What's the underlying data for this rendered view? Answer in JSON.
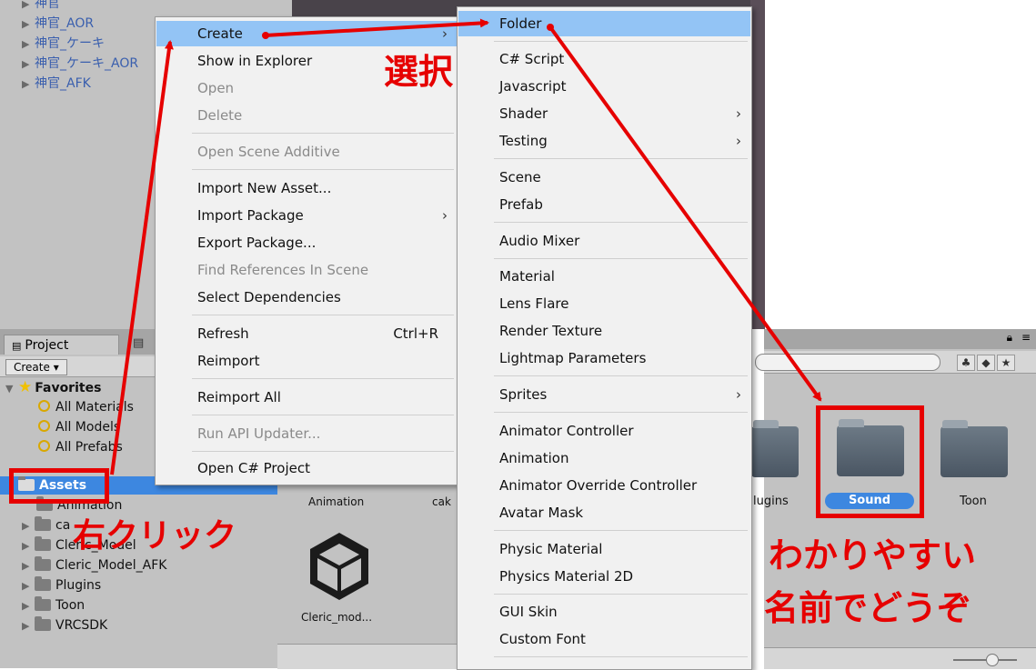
{
  "hierarchy": {
    "items": [
      "神官",
      "神官_AOR",
      "神官_ケーキ",
      "神官_ケーキ_AOR",
      "神官_AFK"
    ]
  },
  "project_panel": {
    "tab_label": "Project",
    "create_label": "Create ▾",
    "favorites": "Favorites",
    "favorite_items": [
      "All Materials",
      "All Models",
      "All Prefabs"
    ],
    "assets_label": "Assets",
    "asset_folders": [
      "Animation",
      "ca",
      "Cleric_Model",
      "Cleric_Model_AFK",
      "Plugins",
      "Toon",
      "VRCSDK"
    ]
  },
  "asset_grid": {
    "labels": [
      "Animation",
      "cak",
      "Cleric_mod..."
    ]
  },
  "right_pane": {
    "folder_labels": [
      "lugins",
      "Sound",
      "Toon"
    ]
  },
  "context_menu": {
    "items": [
      {
        "label": "Create",
        "arrow": "›"
      },
      {
        "label": "Show in Explorer"
      },
      {
        "label": "Open"
      },
      {
        "label": "Delete"
      },
      {
        "label": "Open Scene Additive"
      },
      {
        "label": "Import New Asset..."
      },
      {
        "label": "Import Package",
        "arrow": "›"
      },
      {
        "label": "Export Package..."
      },
      {
        "label": "Find References In Scene"
      },
      {
        "label": "Select Dependencies"
      },
      {
        "label": "Refresh",
        "shortcut": "Ctrl+R"
      },
      {
        "label": "Reimport"
      },
      {
        "label": "Reimport All"
      },
      {
        "label": "Run API Updater..."
      },
      {
        "label": "Open C# Project"
      }
    ]
  },
  "create_submenu": {
    "items": [
      {
        "label": "Folder"
      },
      {
        "label": "C# Script"
      },
      {
        "label": "Javascript"
      },
      {
        "label": "Shader",
        "arrow": "›"
      },
      {
        "label": "Testing",
        "arrow": "›"
      },
      {
        "label": "Scene"
      },
      {
        "label": "Prefab"
      },
      {
        "label": "Audio Mixer"
      },
      {
        "label": "Material"
      },
      {
        "label": "Lens Flare"
      },
      {
        "label": "Render Texture"
      },
      {
        "label": "Lightmap Parameters"
      },
      {
        "label": "Sprites",
        "arrow": "›"
      },
      {
        "label": "Animator Controller"
      },
      {
        "label": "Animation"
      },
      {
        "label": "Animator Override Controller"
      },
      {
        "label": "Avatar Mask"
      },
      {
        "label": "Physic Material"
      },
      {
        "label": "Physics Material 2D"
      },
      {
        "label": "GUI Skin"
      },
      {
        "label": "Custom Font"
      }
    ]
  },
  "annotations": {
    "select": "選択",
    "right_click": "右クリック",
    "hint_line1": "わかりやすい",
    "hint_line2": "名前でどうぞ",
    "color": "#e60000"
  }
}
